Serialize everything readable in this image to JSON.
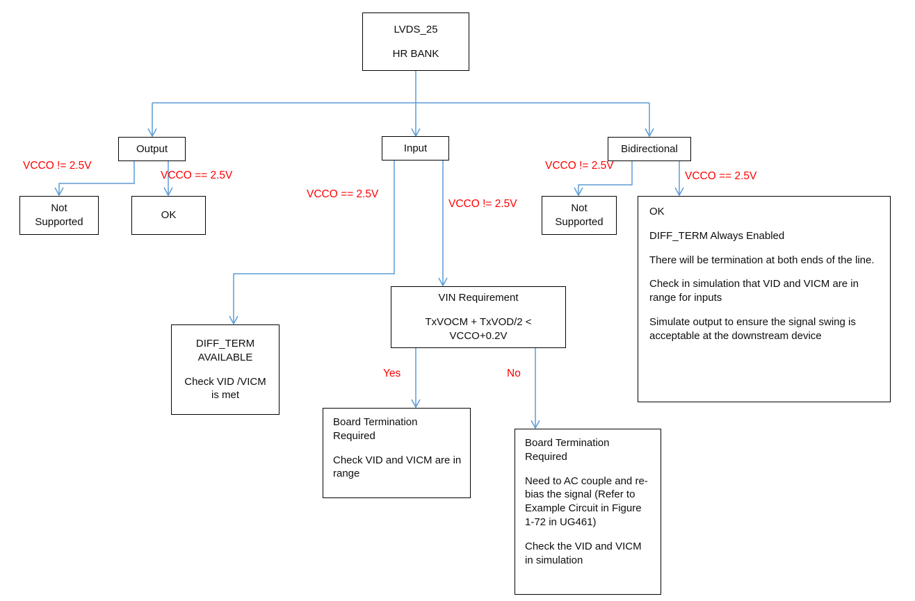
{
  "diagram": {
    "title": "LVDS_25 HR BANK configuration decision flowchart",
    "colors": {
      "connector": "#5b9bd5",
      "edge_label": "#ff0000",
      "node_border": "#000000",
      "node_fill": "#ffffff",
      "text": "#0d0d0d"
    }
  },
  "nodes": {
    "root": {
      "line1": "LVDS_25",
      "line2": "HR BANK"
    },
    "output": {
      "label": "Output"
    },
    "input": {
      "label": "Input"
    },
    "bidirectional": {
      "label": "Bidirectional"
    },
    "output_not_supported": {
      "line1": "Not",
      "line2": "Supported"
    },
    "output_ok": {
      "label": "OK"
    },
    "bidir_not_supported": {
      "line1": "Not",
      "line2": "Supported"
    },
    "bidir_ok": {
      "p1": "OK",
      "p2": "DIFF_TERM Always Enabled",
      "p3": "There will be termination at both ends of the line.",
      "p4": "Check in simulation that VID and VICM are in range for inputs",
      "p5": "Simulate output to ensure the signal swing is acceptable at the downstream device"
    },
    "diff_term_available": {
      "line1": "DIFF_TERM",
      "line2": "AVAILABLE",
      "line3": "Check VID /VICM",
      "line4": "is met"
    },
    "vin_requirement": {
      "line1": "VIN Requirement",
      "line2": "TxVOCM + TxVOD/2 <",
      "line3": "VCCO+0.2V"
    },
    "board_term_yes": {
      "p1": "Board Termination\nRequired",
      "p2": "Check VID and VICM are\nin range"
    },
    "board_term_no": {
      "p1": "Board Termination\nRequired",
      "p2": "Need to AC couple and\nre-bias the signal (Refer\nto Example Circuit in\nFigure 1-72 in UG461)",
      "p3": "Check the VID and VICM\nin simulation"
    }
  },
  "edge_labels": {
    "output_not_supported": "VCCO != 2.5V",
    "output_ok": "VCCO == 2.5V",
    "input_left": "VCCO == 2.5V",
    "input_right": "VCCO != 2.5V",
    "bidir_not_supported": "VCCO != 2.5V",
    "bidir_ok": "VCCO == 2.5V",
    "vin_yes": "Yes",
    "vin_no": "No"
  }
}
